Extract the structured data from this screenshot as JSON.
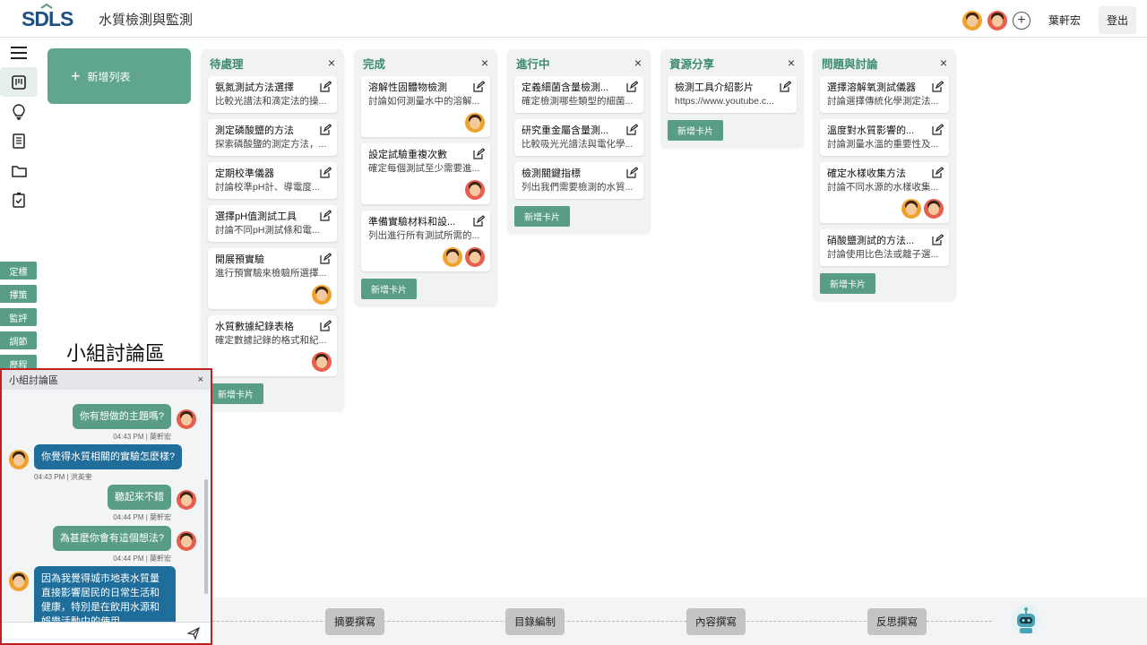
{
  "header": {
    "logo_text": "SDLS",
    "title": "水質檢測與監測",
    "user_name": "葉軒宏",
    "logout_label": "登出",
    "add_member_symbol": "+"
  },
  "sidebar": {
    "icons": [
      "menu-icon",
      "kanban-icon",
      "lightbulb-icon",
      "document-icon",
      "folder-icon",
      "checklist-icon"
    ],
    "tags": [
      "定標",
      "擇策",
      "監評",
      "調節",
      "歷程"
    ]
  },
  "add_list": {
    "symbol": "+",
    "label": "新增列表"
  },
  "columns": [
    {
      "title": "待處理",
      "close": "×",
      "add_card": "新增卡片",
      "cards": [
        {
          "title": "氨氮測試方法選擇",
          "desc": "比較光譜法和滴定法的操..."
        },
        {
          "title": "測定磷酸鹽的方法",
          "desc": "探索磷酸鹽的測定方法，..."
        },
        {
          "title": "定期校準儀器",
          "desc": "討論校準pH計、導電度..."
        },
        {
          "title": "選擇pH值測試工具",
          "desc": "討論不同pH測試條和電..."
        },
        {
          "title": "開展預實驗",
          "desc": "進行預實驗來檢驗所選擇...",
          "avatars": [
            "orange"
          ]
        },
        {
          "title": "水質數據紀錄表格",
          "desc": "確定數據記錄的格式和紀...",
          "avatars": [
            "red"
          ]
        }
      ]
    },
    {
      "title": "完成",
      "close": "×",
      "add_card": "新增卡片",
      "cards": [
        {
          "title": "溶解性固體物檢測",
          "desc": "討論如何測量水中的溶解...",
          "avatars": [
            "orange"
          ]
        },
        {
          "title": "設定試驗重複次數",
          "desc": "確定每個測試至少需要進...",
          "avatars": [
            "red"
          ]
        },
        {
          "title": "準備實驗材料和設...",
          "desc": "列出進行所有測試所需的...",
          "avatars": [
            "orange",
            "red"
          ]
        }
      ]
    },
    {
      "title": "進行中",
      "close": "×",
      "add_card": "新增卡片",
      "cards": [
        {
          "title": "定義細菌含量檢測...",
          "desc": "確定檢測哪些類型的細菌..."
        },
        {
          "title": "研究重金屬含量測...",
          "desc": "比較吸光光譜法與電化學..."
        },
        {
          "title": "檢測關鍵指標",
          "desc": "列出我們需要檢測的水質..."
        }
      ]
    },
    {
      "title": "資源分享",
      "close": "×",
      "add_card": "新增卡片",
      "cards": [
        {
          "title": "檢測工具介紹影片",
          "desc": "https://www.youtube.c..."
        }
      ]
    },
    {
      "title": "問題與討論",
      "close": "×",
      "add_card": "新增卡片",
      "cards": [
        {
          "title": "選擇溶解氧測試儀器",
          "desc": "討論選擇傳統化學測定法..."
        },
        {
          "title": "溫度對水質影響的...",
          "desc": "討論測量水溫的重要性及..."
        },
        {
          "title": "確定水樣收集方法",
          "desc": "討論不同水源的水樣收集...",
          "avatars": [
            "orange",
            "red"
          ]
        },
        {
          "title": "硝酸鹽測試的方法...",
          "desc": "討論使用比色法或離子選..."
        }
      ]
    }
  ],
  "chat": {
    "heading": "小組討論區",
    "panel_title": "小組討論區",
    "close": "×",
    "messages": [
      {
        "text": "你有想做的主題嗎?",
        "meta": "04:43 PM | 葉軒宏",
        "side": "right"
      },
      {
        "text": "你覺得水質相關的實驗怎麼樣?",
        "meta": "04:43 PM | 洪英奎",
        "side": "left"
      },
      {
        "text": "聽起來不錯",
        "meta": "04:44 PM | 葉軒宏",
        "side": "right"
      },
      {
        "text": "為甚麼你會有這個想法?",
        "meta": "04:44 PM | 葉軒宏",
        "side": "right"
      },
      {
        "text": "因為我覺得城市地表水質量直接影響居民的日常生活和健康，特別是在飲用水源和娛樂活動中的使用。",
        "meta": "",
        "side": "left"
      }
    ]
  },
  "stepper": {
    "steps": [
      "摘要撰寫",
      "目錄編制",
      "內容撰寫",
      "反思撰寫"
    ]
  },
  "colors": {
    "accent": "#5a9d87",
    "column_title": "#3d8a73",
    "chat_blue": "#1f6d9b",
    "chat_border": "#c0201f"
  }
}
